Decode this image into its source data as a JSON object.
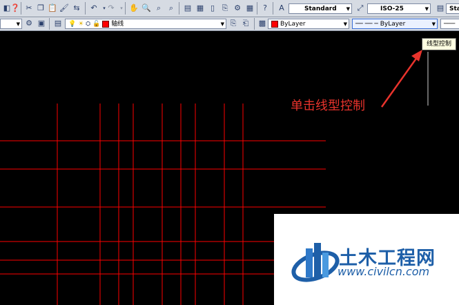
{
  "toolbar_top": {
    "text_style": "Standard",
    "dim_style": "ISO-25",
    "table_style_partial": "Sta"
  },
  "toolbar_layers": {
    "layer_name": "轴线",
    "color": "ByLayer",
    "linetype": "ByLayer"
  },
  "tooltip": "线型控制",
  "annotation": "单击线型控制",
  "watermark": {
    "brand": "土木工程网",
    "url": "www.civilcn.com"
  },
  "colors": {
    "grid_line": "#ff0000",
    "annotation": "#e8332c",
    "toolbar_bg": "#d6dbe3",
    "brand_blue": "#1e5fa8"
  }
}
